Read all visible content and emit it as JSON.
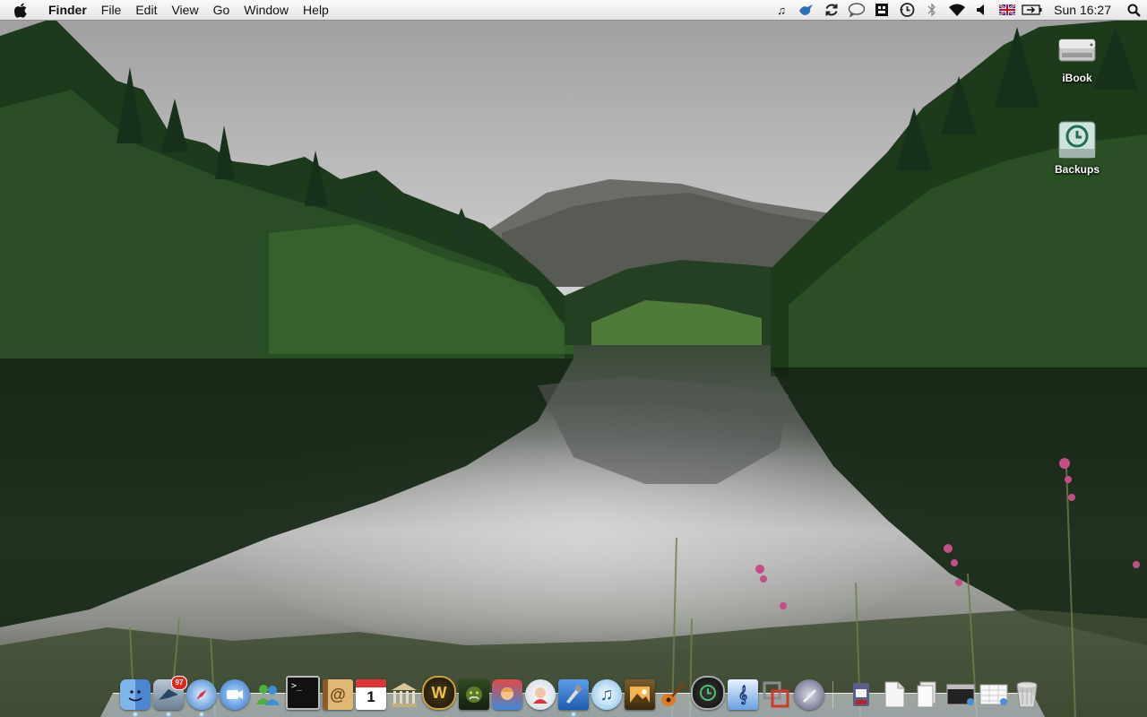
{
  "menubar": {
    "app_name": "Finder",
    "menus": [
      "File",
      "Edit",
      "View",
      "Go",
      "Window",
      "Help"
    ],
    "clock": "Sun 16:27",
    "status_icons": [
      "itunes-note-icon",
      "bird-icon",
      "sync-icon",
      "chat-bubble-icon",
      "remote-icon",
      "time-machine-icon",
      "bluetooth-icon",
      "wifi-icon",
      "volume-icon",
      "uk-flag-icon",
      "battery-icon"
    ]
  },
  "desktop": {
    "icons": [
      {
        "name": "hard-drive-icon",
        "label": "iBook"
      },
      {
        "name": "time-machine-drive-icon",
        "label": "Backups"
      }
    ]
  },
  "dock": {
    "mail_badge": "97",
    "calendar_day": "1",
    "app_icons": [
      "finder-icon",
      "mail-icon",
      "safari-icon",
      "ichat-icon",
      "msn-icon",
      "terminal-icon",
      "address-book-icon",
      "calendar-icon",
      "library-icon",
      "warcraft-icon",
      "orc-icon",
      "game-icon",
      "ukelele-icon",
      "xcode-icon",
      "itunes-icon",
      "iphoto-icon",
      "garageband-icon",
      "time-machine-icon",
      "mosaic-icon",
      "parallels-icon",
      "script-editor-icon"
    ],
    "stack_icons": [
      "archive-icon",
      "document-icon",
      "document-stack-icon",
      "terminal-stack-icon",
      "sheet-stack-icon",
      "trash-icon"
    ]
  },
  "colors": {
    "menubar_top": "#fbfbfb",
    "menubar_bottom": "#e4e4e4",
    "badge": "#e0281f"
  }
}
